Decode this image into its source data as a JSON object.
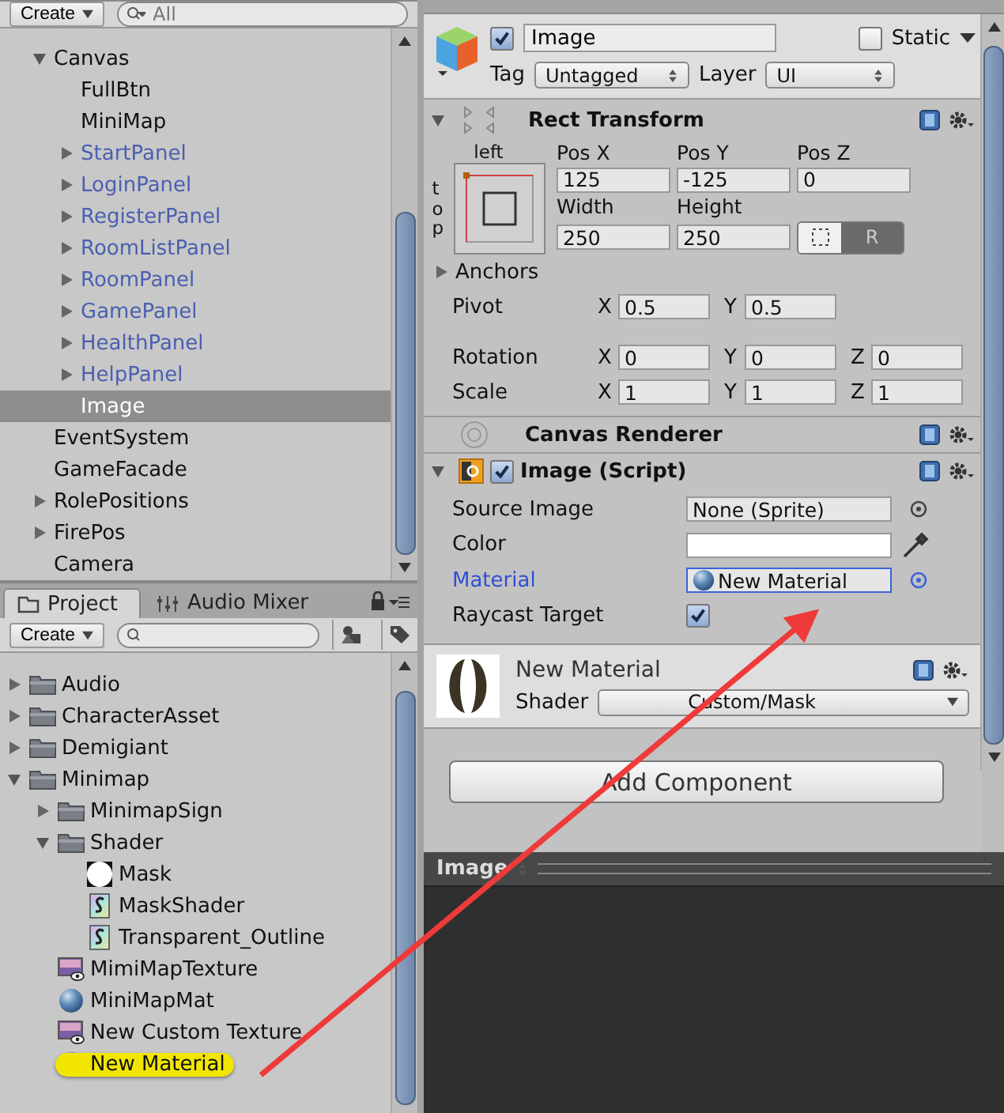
{
  "hierarchy": {
    "create": "Create",
    "search_placeholder": "All",
    "items": [
      {
        "name": "Canvas",
        "has_children": true,
        "expanded": true,
        "prefab": false,
        "selected": false,
        "children": [
          {
            "name": "FullBtn",
            "has_children": false,
            "prefab": false,
            "selected": false
          },
          {
            "name": "MiniMap",
            "has_children": false,
            "prefab": false,
            "selected": false
          },
          {
            "name": "StartPanel",
            "has_children": true,
            "expanded": false,
            "prefab": true,
            "selected": false
          },
          {
            "name": "LoginPanel",
            "has_children": true,
            "expanded": false,
            "prefab": true,
            "selected": false
          },
          {
            "name": "RegisterPanel",
            "has_children": true,
            "expanded": false,
            "prefab": true,
            "selected": false
          },
          {
            "name": "RoomListPanel",
            "has_children": true,
            "expanded": false,
            "prefab": true,
            "selected": false
          },
          {
            "name": "RoomPanel",
            "has_children": true,
            "expanded": false,
            "prefab": true,
            "selected": false
          },
          {
            "name": "GamePanel",
            "has_children": true,
            "expanded": false,
            "prefab": true,
            "selected": false
          },
          {
            "name": "HealthPanel",
            "has_children": true,
            "expanded": false,
            "prefab": true,
            "selected": false
          },
          {
            "name": "HelpPanel",
            "has_children": true,
            "expanded": false,
            "prefab": true,
            "selected": false
          },
          {
            "name": "Image",
            "has_children": false,
            "prefab": false,
            "selected": true
          }
        ]
      },
      {
        "name": "EventSystem",
        "has_children": false,
        "prefab": false,
        "selected": false
      },
      {
        "name": "GameFacade",
        "has_children": false,
        "prefab": false,
        "selected": false
      },
      {
        "name": "RolePositions",
        "has_children": true,
        "expanded": false,
        "prefab": false,
        "selected": false
      },
      {
        "name": "FirePos",
        "has_children": true,
        "expanded": false,
        "prefab": false,
        "selected": false
      },
      {
        "name": "Camera",
        "has_children": false,
        "prefab": false,
        "selected": false
      }
    ]
  },
  "project": {
    "tabs": [
      {
        "label": "Project",
        "kind": "project",
        "selected": true
      },
      {
        "label": "Audio Mixer",
        "kind": "mixer",
        "selected": false
      }
    ],
    "create": "Create",
    "items": [
      {
        "name": "Audio",
        "kind": "folder",
        "has_children": true,
        "expanded": false,
        "selected": false
      },
      {
        "name": "CharacterAsset",
        "kind": "folder",
        "has_children": true,
        "expanded": false,
        "selected": false
      },
      {
        "name": "Demigiant",
        "kind": "folder",
        "has_children": true,
        "expanded": false,
        "selected": false
      },
      {
        "name": "Minimap",
        "kind": "folder",
        "has_children": true,
        "expanded": true,
        "selected": false,
        "children": [
          {
            "name": "MinimapSign",
            "kind": "folder",
            "has_children": true,
            "expanded": false,
            "selected": false
          },
          {
            "name": "Shader",
            "kind": "folder",
            "has_children": true,
            "expanded": true,
            "selected": false,
            "children": [
              {
                "name": "Mask",
                "kind": "sprite",
                "has_children": false,
                "selected": false
              },
              {
                "name": "MaskShader",
                "kind": "shader",
                "has_children": false,
                "selected": false
              },
              {
                "name": "Transparent_Outline",
                "kind": "shader",
                "has_children": false,
                "selected": false
              }
            ]
          },
          {
            "name": "MimiMapTexture",
            "kind": "texture",
            "has_children": false,
            "selected": false
          },
          {
            "name": "MiniMapMat",
            "kind": "material",
            "has_children": false,
            "selected": false
          },
          {
            "name": "New Custom Texture",
            "kind": "texture",
            "has_children": false,
            "selected": false
          },
          {
            "name": "New Material",
            "kind": "material",
            "has_children": false,
            "selected": true
          }
        ]
      }
    ]
  },
  "inspector": {
    "object": {
      "active": true,
      "name": "Image",
      "static": false,
      "static_label": "Static",
      "tag_label": "Tag",
      "tag": "Untagged",
      "layer_label": "Layer",
      "layer": "UI"
    },
    "rect_transform": {
      "title": "Rect Transform",
      "anchor_h": "left",
      "anchor_v": "top",
      "position_fields": [
        {
          "label": "Pos X",
          "value": "125"
        },
        {
          "label": "Pos Y",
          "value": "-125"
        },
        {
          "label": "Pos Z",
          "value": "0"
        }
      ],
      "size_fields": [
        {
          "label": "Width",
          "value": "250"
        },
        {
          "label": "Height",
          "value": "250"
        }
      ],
      "raw_button": "R",
      "anchors_label": "Anchors",
      "vector_rows": [
        {
          "label": "Pivot",
          "fields": [
            {
              "axis": "X",
              "value": "0.5"
            },
            {
              "axis": "Y",
              "value": "0.5"
            }
          ]
        },
        {
          "label": "Rotation",
          "fields": [
            {
              "axis": "X",
              "value": "0"
            },
            {
              "axis": "Y",
              "value": "0"
            },
            {
              "axis": "Z",
              "value": "0"
            }
          ]
        },
        {
          "label": "Scale",
          "fields": [
            {
              "axis": "X",
              "value": "1"
            },
            {
              "axis": "Y",
              "value": "1"
            },
            {
              "axis": "Z",
              "value": "1"
            }
          ]
        }
      ]
    },
    "canvas_renderer": {
      "title": "Canvas Renderer"
    },
    "image_script": {
      "title": "Image (Script)",
      "enabled": true,
      "properties": [
        {
          "kind": "object",
          "label": "Source Image",
          "value": "None (Sprite)",
          "highlighted": false
        },
        {
          "kind": "color",
          "label": "Color",
          "color": "#ffffff",
          "highlighted": false
        },
        {
          "kind": "material_object",
          "label": "Material",
          "value": "New Material",
          "highlighted": true
        },
        {
          "kind": "checkbox",
          "label": "Raycast Target",
          "checked": true,
          "highlighted": false
        }
      ]
    },
    "material": {
      "name": "New Material",
      "shader_label": "Shader",
      "shader": "Custom/Mask"
    },
    "add_component": "Add Component",
    "preview": {
      "title": "Image"
    }
  }
}
